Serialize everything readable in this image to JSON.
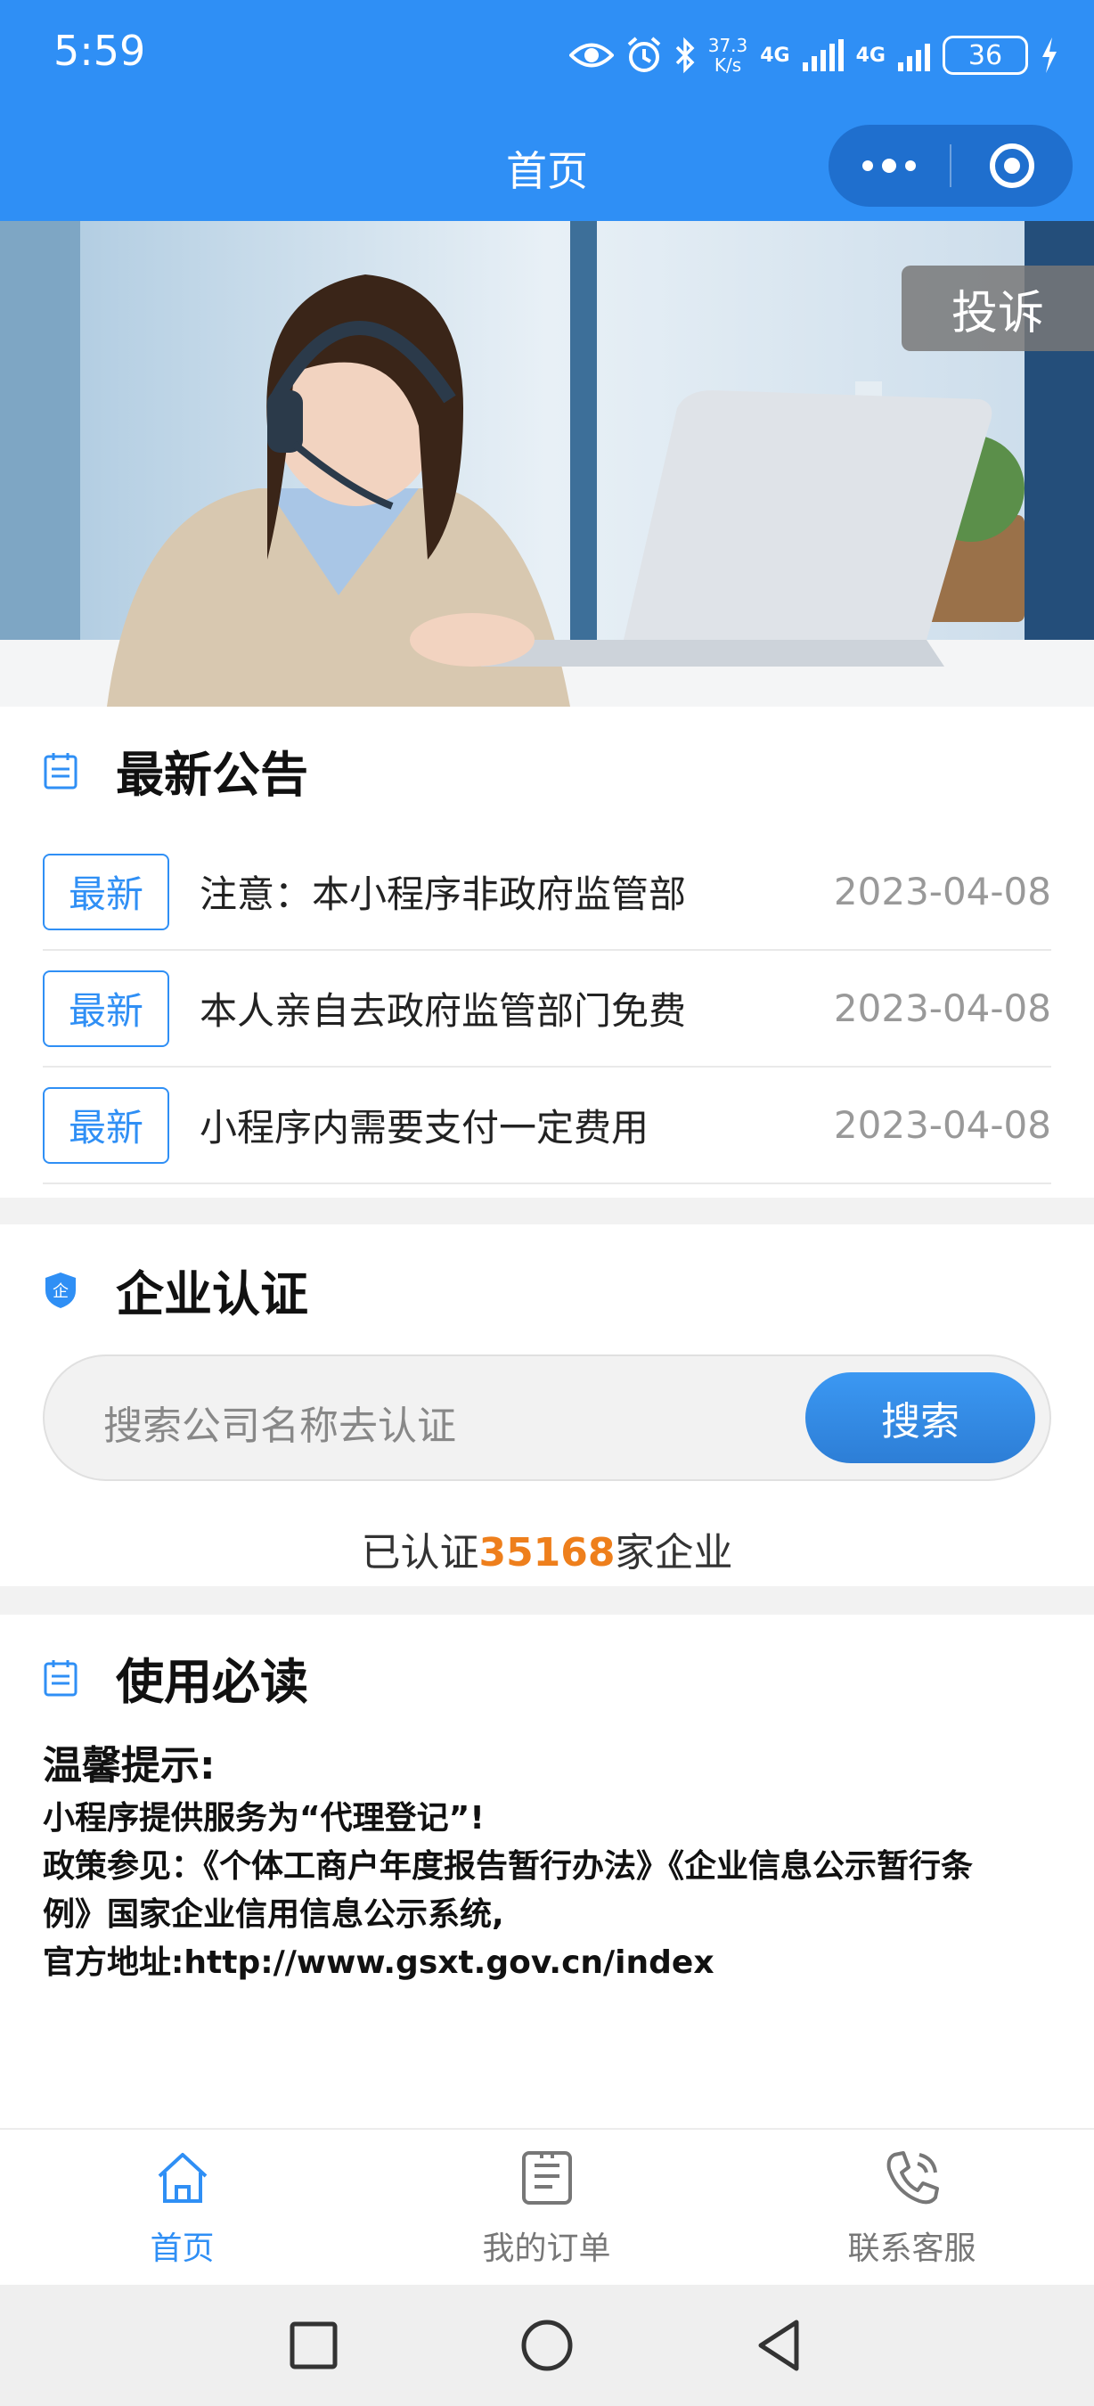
{
  "status_bar": {
    "time": "5:59",
    "speed_value": "37.3",
    "speed_unit": "K/s",
    "network_1": "4G",
    "network_2": "4G",
    "battery": "36"
  },
  "nav": {
    "title": "首页"
  },
  "banner": {
    "complaint_label": "投诉"
  },
  "announcements": {
    "title": "最新公告",
    "items": [
      {
        "tag": "最新",
        "text": "注意：本小程序非政府监管部",
        "date": "2023-04-08"
      },
      {
        "tag": "最新",
        "text": "本人亲自去政府监管部门免费",
        "date": "2023-04-08"
      },
      {
        "tag": "最新",
        "text": "小程序内需要支付一定费用",
        "date": "2023-04-08"
      }
    ]
  },
  "certification": {
    "title": "企业认证",
    "badge_char": "企",
    "search_placeholder": "搜索公司名称去认证",
    "search_button": "搜索",
    "count_prefix": "已认证",
    "count_value": "35168",
    "count_suffix": "家企业"
  },
  "guide": {
    "title": "使用必读",
    "heading": "温馨提示:",
    "lines": [
      "小程序提供服务为“代理登记”!",
      "政策参见：《个体工商户年度报告暂行办法》《企业信息公示暂行条",
      "例》国家企业信用信息公示系统,",
      "官方地址:http://www.gsxt.gov.cn/index"
    ]
  },
  "tabbar": {
    "items": [
      {
        "label": "首页",
        "icon": "home-icon",
        "active": true
      },
      {
        "label": "我的订单",
        "icon": "order-icon",
        "active": false
      },
      {
        "label": "联系客服",
        "icon": "phone-icon",
        "active": false
      }
    ]
  },
  "colors": {
    "primary": "#2f8ff5",
    "highlight": "#ee7f1c",
    "date": "#999999"
  }
}
